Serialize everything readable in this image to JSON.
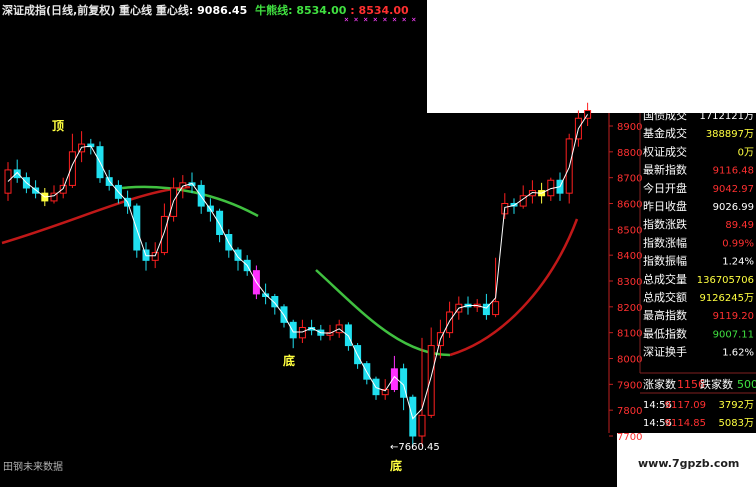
{
  "header": {
    "title": "深证成指(日线,前复权) 重心线 重心线:",
    "zhongxin_value": "9086.45",
    "niuxiong_label": "牛熊线:",
    "niuxiong_value": "8534.00",
    "bear_value": "8534.00",
    "separator": ":"
  },
  "chart": {
    "annotations": {
      "top": "顶",
      "bottom1": "底",
      "bottom2": "底",
      "low": "←7660.45"
    },
    "footer_left": "田钢未来数据",
    "watermark": "www.7gpzb.com",
    "colors": {
      "background": "#000000",
      "up": "#ff2020",
      "down": "#20e0f0",
      "bull": "#40c040",
      "bear": "#c01818",
      "magenta": "#ff30ff",
      "yellow": "#ffff40"
    }
  },
  "chart_data": {
    "type": "candlestick",
    "y_ticks": [
      "8900",
      "8800",
      "8700",
      "8600",
      "8500",
      "8400",
      "8300",
      "8200",
      "8100",
      "8000",
      "7900",
      "7800",
      "7700"
    ],
    "ylim": [
      7660,
      8980
    ],
    "candles": [
      {
        "o": 8640,
        "c": 8730,
        "h": 8760,
        "l": 8610
      },
      {
        "o": 8730,
        "c": 8700,
        "h": 8770,
        "l": 8680
      },
      {
        "o": 8700,
        "c": 8660,
        "h": 8720,
        "l": 8640
      },
      {
        "o": 8660,
        "c": 8640,
        "h": 8690,
        "l": 8620
      },
      {
        "o": 8640,
        "c": 8610,
        "h": 8660,
        "l": 8590
      },
      {
        "o": 8610,
        "c": 8640,
        "h": 8670,
        "l": 8600
      },
      {
        "o": 8640,
        "c": 8670,
        "h": 8700,
        "l": 8620
      },
      {
        "o": 8670,
        "c": 8800,
        "h": 8870,
        "l": 8660
      },
      {
        "o": 8800,
        "c": 8830,
        "h": 8880,
        "l": 8760
      },
      {
        "o": 8830,
        "c": 8820,
        "h": 8850,
        "l": 8790
      },
      {
        "o": 8820,
        "c": 8700,
        "h": 8840,
        "l": 8680
      },
      {
        "o": 8700,
        "c": 8670,
        "h": 8730,
        "l": 8650
      },
      {
        "o": 8670,
        "c": 8620,
        "h": 8690,
        "l": 8600
      },
      {
        "o": 8620,
        "c": 8590,
        "h": 8650,
        "l": 8560
      },
      {
        "o": 8590,
        "c": 8420,
        "h": 8600,
        "l": 8390
      },
      {
        "o": 8420,
        "c": 8380,
        "h": 8450,
        "l": 8340
      },
      {
        "o": 8380,
        "c": 8410,
        "h": 8450,
        "l": 8350
      },
      {
        "o": 8410,
        "c": 8550,
        "h": 8600,
        "l": 8400
      },
      {
        "o": 8550,
        "c": 8660,
        "h": 8700,
        "l": 8530
      },
      {
        "o": 8660,
        "c": 8680,
        "h": 8710,
        "l": 8620
      },
      {
        "o": 8680,
        "c": 8670,
        "h": 8720,
        "l": 8640
      },
      {
        "o": 8670,
        "c": 8590,
        "h": 8690,
        "l": 8560
      },
      {
        "o": 8590,
        "c": 8570,
        "h": 8620,
        "l": 8530
      },
      {
        "o": 8570,
        "c": 8480,
        "h": 8580,
        "l": 8450
      },
      {
        "o": 8480,
        "c": 8420,
        "h": 8500,
        "l": 8390
      },
      {
        "o": 8420,
        "c": 8380,
        "h": 8430,
        "l": 8340
      },
      {
        "o": 8380,
        "c": 8340,
        "h": 8400,
        "l": 8320
      },
      {
        "o": 8340,
        "c": 8250,
        "h": 8360,
        "l": 8230
      },
      {
        "o": 8250,
        "c": 8240,
        "h": 8290,
        "l": 8210
      },
      {
        "o": 8240,
        "c": 8200,
        "h": 8250,
        "l": 8170
      },
      {
        "o": 8200,
        "c": 8140,
        "h": 8210,
        "l": 8120
      },
      {
        "o": 8140,
        "c": 8080,
        "h": 8150,
        "l": 8040
      },
      {
        "o": 8080,
        "c": 8120,
        "h": 8150,
        "l": 8060
      },
      {
        "o": 8120,
        "c": 8110,
        "h": 8150,
        "l": 8090
      },
      {
        "o": 8110,
        "c": 8090,
        "h": 8130,
        "l": 8070
      },
      {
        "o": 8090,
        "c": 8100,
        "h": 8130,
        "l": 8070
      },
      {
        "o": 8100,
        "c": 8130,
        "h": 8150,
        "l": 8080
      },
      {
        "o": 8130,
        "c": 8050,
        "h": 8140,
        "l": 8030
      },
      {
        "o": 8050,
        "c": 7980,
        "h": 8060,
        "l": 7960
      },
      {
        "o": 7980,
        "c": 7920,
        "h": 7990,
        "l": 7900
      },
      {
        "o": 7920,
        "c": 7860,
        "h": 7930,
        "l": 7840
      },
      {
        "o": 7860,
        "c": 7880,
        "h": 7920,
        "l": 7840
      },
      {
        "o": 7880,
        "c": 7960,
        "h": 8010,
        "l": 7870
      },
      {
        "o": 7960,
        "c": 7850,
        "h": 7980,
        "l": 7800
      },
      {
        "o": 7850,
        "c": 7700,
        "h": 7860,
        "l": 7660
      },
      {
        "o": 7700,
        "c": 7780,
        "h": 8080,
        "l": 7660
      },
      {
        "o": 7780,
        "c": 8050,
        "h": 8120,
        "l": 7770
      },
      {
        "o": 8050,
        "c": 8100,
        "h": 8150,
        "l": 8000
      },
      {
        "o": 8100,
        "c": 8180,
        "h": 8220,
        "l": 8080
      },
      {
        "o": 8180,
        "c": 8210,
        "h": 8240,
        "l": 8150
      },
      {
        "o": 8210,
        "c": 8200,
        "h": 8240,
        "l": 8170
      },
      {
        "o": 8200,
        "c": 8210,
        "h": 8230,
        "l": 8180
      },
      {
        "o": 8210,
        "c": 8170,
        "h": 8250,
        "l": 8150
      },
      {
        "o": 8170,
        "c": 8220,
        "h": 8390,
        "l": 8160
      },
      {
        "o": 8560,
        "c": 8600,
        "h": 8640,
        "l": 8540
      },
      {
        "o": 8600,
        "c": 8590,
        "h": 8620,
        "l": 8560
      },
      {
        "o": 8590,
        "c": 8630,
        "h": 8670,
        "l": 8580
      },
      {
        "o": 8630,
        "c": 8650,
        "h": 8690,
        "l": 8600
      },
      {
        "o": 8650,
        "c": 8630,
        "h": 8680,
        "l": 8600
      },
      {
        "o": 8630,
        "c": 8690,
        "h": 8700,
        "l": 8610
      },
      {
        "o": 8690,
        "c": 8640,
        "h": 8720,
        "l": 8610
      },
      {
        "o": 8640,
        "c": 8850,
        "h": 8870,
        "l": 8600
      },
      {
        "o": 8850,
        "c": 8930,
        "h": 8960,
        "l": 8820
      },
      {
        "o": 8930,
        "c": 8960,
        "h": 8990,
        "l": 8900
      }
    ],
    "highlight_candles": {
      "yellow": [
        4,
        58
      ],
      "magenta": [
        27,
        42
      ]
    }
  },
  "panel": {
    "rows": [
      {
        "label": "国债成交",
        "value": "1712121万",
        "value_color": "#ffffff"
      },
      {
        "label": "基金成交",
        "value": "388897万",
        "value_color": "#ffff40"
      },
      {
        "label": "权证成交",
        "value": "0万",
        "value_color": "#ffff40"
      },
      {
        "label": "最新指数",
        "value": "9116.48",
        "value_color": "#ff3030"
      },
      {
        "label": "今日开盘",
        "value": "9042.97",
        "value_color": "#ff3030"
      },
      {
        "label": "昨日收盘",
        "value": "9026.99",
        "value_color": "#ffffff"
      },
      {
        "label": "指数涨跌",
        "value": "89.49",
        "value_color": "#ff3030"
      },
      {
        "label": "指数涨幅",
        "value": "0.99%",
        "value_color": "#ff3030"
      },
      {
        "label": "指数振幅",
        "value": "1.24%",
        "value_color": "#ffffff"
      },
      {
        "label": "总成交量",
        "value": "136705706",
        "value_color": "#ffff40"
      },
      {
        "label": "总成交额",
        "value": "9126245万",
        "value_color": "#ffff40"
      },
      {
        "label": "最高指数",
        "value": "9119.20",
        "value_color": "#ff3030"
      },
      {
        "label": "最低指数",
        "value": "9007.11",
        "value_color": "#40e040"
      },
      {
        "label": "深证换手",
        "value": "1.62%",
        "value_color": "#ffffff"
      }
    ],
    "breadth": {
      "up_label": "涨家数",
      "up_value": "1156",
      "down_label": "跌家数",
      "down_value": "500"
    },
    "ticks": [
      {
        "time": "14:56",
        "price": "9117.09",
        "vol": "3792万"
      },
      {
        "time": "14:56",
        "price": "9114.85",
        "vol": "5083万"
      }
    ]
  }
}
